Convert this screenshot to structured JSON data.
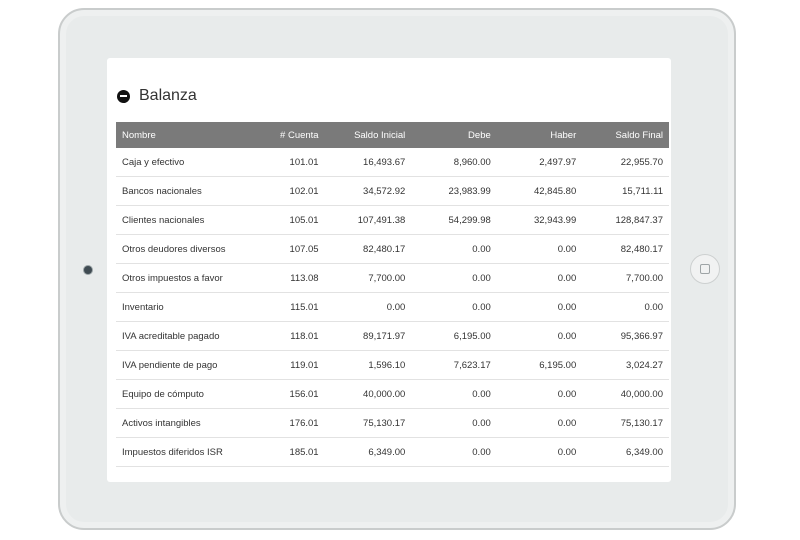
{
  "panel": {
    "title": "Balanza",
    "icon": "minus-circle-icon"
  },
  "table": {
    "columns": [
      "Nombre",
      "# Cuenta",
      "Saldo Inicial",
      "Debe",
      "Haber",
      "Saldo Final"
    ],
    "rows": [
      [
        "Caja y efectivo",
        "101.01",
        "16,493.67",
        "8,960.00",
        "2,497.97",
        "22,955.70"
      ],
      [
        "Bancos nacionales",
        "102.01",
        "34,572.92",
        "23,983.99",
        "42,845.80",
        "15,711.11"
      ],
      [
        "Clientes nacionales",
        "105.01",
        "107,491.38",
        "54,299.98",
        "32,943.99",
        "128,847.37"
      ],
      [
        "Otros deudores diversos",
        "107.05",
        "82,480.17",
        "0.00",
        "0.00",
        "82,480.17"
      ],
      [
        "Otros impuestos a favor",
        "113.08",
        "7,700.00",
        "0.00",
        "0.00",
        "7,700.00"
      ],
      [
        "Inventario",
        "115.01",
        "0.00",
        "0.00",
        "0.00",
        "0.00"
      ],
      [
        "IVA acreditable pagado",
        "118.01",
        "89,171.97",
        "6,195.00",
        "0.00",
        "95,366.97"
      ],
      [
        "IVA pendiente de pago",
        "119.01",
        "1,596.10",
        "7,623.17",
        "6,195.00",
        "3,024.27"
      ],
      [
        "Equipo de cómputo",
        "156.01",
        "40,000.00",
        "0.00",
        "0.00",
        "40,000.00"
      ],
      [
        "Activos intangibles",
        "176.01",
        "75,130.17",
        "0.00",
        "0.00",
        "75,130.17"
      ],
      [
        "Impuestos diferidos ISR",
        "185.01",
        "6,349.00",
        "0.00",
        "0.00",
        "6,349.00"
      ]
    ]
  },
  "colors": {
    "header_bg": "#7a7a7a",
    "device_frame": "#e8ebeb",
    "text": "#333333"
  }
}
